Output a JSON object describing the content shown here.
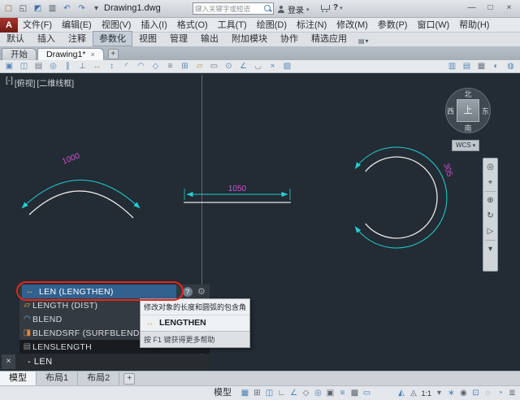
{
  "colors": {
    "canvas_bg": "#232b34",
    "entity_white": "#e8e8e8",
    "entity_cyan": "#21d1d1",
    "dimension_magenta": "#d24fd2",
    "suggestion_highlight": "#30618f",
    "annotation_red": "#e8241b"
  },
  "titlebar": {
    "qat_icons": [
      {
        "name": "new-file-icon",
        "glyph": "▢"
      },
      {
        "name": "open-file-icon",
        "glyph": "◱"
      },
      {
        "name": "save-icon",
        "glyph": "◩"
      },
      {
        "name": "plot-icon",
        "glyph": "▥"
      },
      {
        "name": "undo-icon",
        "glyph": "↶"
      },
      {
        "name": "redo-icon",
        "glyph": "↷"
      },
      {
        "name": "qat-dropdown-icon",
        "glyph": "▾"
      }
    ],
    "title": "Drawing1.dwg",
    "search_placeholder": "键入关键字或短语",
    "login_label": "登录",
    "help_label": "?",
    "minimize_glyph": "—",
    "maximize_glyph": "□",
    "close_glyph": "×"
  },
  "menubar": {
    "logo_letter": "A",
    "items": [
      "文件(F)",
      "编辑(E)",
      "视图(V)",
      "插入(I)",
      "格式(O)",
      "工具(T)",
      "绘图(D)",
      "标注(N)",
      "修改(M)",
      "参数(P)",
      "窗口(W)",
      "帮助(H)"
    ]
  },
  "ribbon_tabs": [
    {
      "label": "默认",
      "active": false
    },
    {
      "label": "插入",
      "active": false
    },
    {
      "label": "注释",
      "active": false
    },
    {
      "label": "参数化",
      "active": true
    },
    {
      "label": "视图",
      "active": false
    },
    {
      "label": "管理",
      "active": false
    },
    {
      "label": "输出",
      "active": false
    },
    {
      "label": "附加模块",
      "active": false
    },
    {
      "label": "协作",
      "active": false
    },
    {
      "label": "精选应用",
      "active": false
    }
  ],
  "file_tabs": {
    "start": "开始",
    "drawing": "Drawing1*"
  },
  "toolbar_icons": [
    {
      "name": "workspace-cube-icon",
      "glyph": "▣"
    },
    {
      "name": "coincident-constraint-icon",
      "glyph": "◫"
    },
    {
      "name": "collinear-constraint-icon",
      "glyph": "▤"
    },
    {
      "name": "concentric-constraint-icon",
      "glyph": "◎"
    },
    {
      "name": "parallel-constraint-icon",
      "glyph": "∥"
    },
    {
      "name": "perpendicular-constraint-icon",
      "glyph": "⊥"
    },
    {
      "name": "horizontal-constraint-icon",
      "glyph": "↔"
    },
    {
      "name": "vertical-constraint-icon",
      "glyph": "↕"
    },
    {
      "name": "tangent-constraint-icon",
      "glyph": "◜"
    },
    {
      "name": "smooth-constraint-icon",
      "glyph": "◠"
    },
    {
      "name": "symmetric-constraint-icon",
      "glyph": "◇"
    },
    {
      "name": "equal-constraint-icon",
      "glyph": "≡"
    },
    {
      "name": "auto-constrain-icon",
      "glyph": "⊞"
    },
    {
      "name": "show-constraints-icon",
      "glyph": "▱"
    },
    {
      "name": "hide-constraints-icon",
      "glyph": "▭"
    },
    {
      "name": "radius-dimension-icon",
      "glyph": "⊙"
    },
    {
      "name": "angular-dimension-icon",
      "glyph": "∠"
    },
    {
      "name": "aligned-dimension-icon",
      "glyph": "◡"
    },
    {
      "name": "delete-constraints-icon",
      "glyph": "×"
    },
    {
      "name": "parameters-manager-icon",
      "glyph": "▨"
    }
  ],
  "toolbar_right_icons": [
    {
      "name": "properties-palette-icon",
      "glyph": "▥"
    },
    {
      "name": "sheet-set-manager-icon",
      "glyph": "▤"
    },
    {
      "name": "tool-palettes-icon",
      "glyph": "▦"
    },
    {
      "name": "materials-browser-icon",
      "glyph": "◐"
    },
    {
      "name": "render-presets-icon",
      "glyph": "◍"
    }
  ],
  "viewport": {
    "controls_minus": "[-]",
    "controls_view": "[俯视]",
    "controls_style": "[二维线框]",
    "viewcube": {
      "north": "北",
      "south": "南",
      "west": "西",
      "east": "东",
      "top": "上",
      "wcs": "WCS"
    },
    "dimensions": {
      "left_arc": "1000",
      "middle_line": "1050",
      "right_arc": "305"
    }
  },
  "navbar_icons": [
    {
      "name": "navigation-wheel-icon",
      "glyph": "◎"
    },
    {
      "name": "pan-icon",
      "glyph": "⌖"
    },
    {
      "name": "zoom-icon",
      "glyph": "⊕"
    },
    {
      "name": "orbit-icon",
      "glyph": "↻"
    },
    {
      "name": "show-motion-icon",
      "glyph": "▷"
    },
    {
      "name": "navbar-options-chevron-icon",
      "glyph": "▾"
    }
  ],
  "command_popup": {
    "suggestions": [
      {
        "label": "LEN (LENGTHEN)",
        "glyph": "↔"
      },
      {
        "label": "LENGTH (DIST)",
        "glyph": "▱"
      },
      {
        "label": "BLEND",
        "glyph": "◠"
      },
      {
        "label": "BLENDSRF (SURFBLEND)",
        "glyph": "◨"
      },
      {
        "label": "LENSLENGTH",
        "glyph": "▤"
      }
    ],
    "help_badge": "?",
    "tooltip": {
      "description": "修改对象的长度和圆弧的包含角",
      "command": "LENGTHEN",
      "help": "按 F1 键获得更多帮助"
    }
  },
  "command_line": {
    "value": "- LEN"
  },
  "layout_tabs": {
    "model": "模型",
    "layout1": "布局1",
    "layout2": "布局2"
  },
  "statusbar": {
    "model_label": "模型",
    "left_icons": [
      {
        "name": "grid-icon",
        "glyph": "▦"
      },
      {
        "name": "snap-icon",
        "glyph": "⊞"
      },
      {
        "name": "infer-constraints-icon",
        "glyph": "◫"
      },
      {
        "name": "ortho-icon",
        "glyph": "∟"
      },
      {
        "name": "polar-tracking-icon",
        "glyph": "∠"
      },
      {
        "name": "isometric-drafting-icon",
        "glyph": "◇"
      },
      {
        "name": "object-snap-tracking-icon",
        "glyph": "◎"
      },
      {
        "name": "object-snap-icon",
        "glyph": "▣"
      },
      {
        "name": "lineweight-icon",
        "glyph": "≡"
      },
      {
        "name": "transparency-icon",
        "glyph": "▩"
      },
      {
        "name": "selection-cycling-icon",
        "glyph": "▭"
      }
    ],
    "right_icons": [
      {
        "name": "annotation-visibility-icon",
        "glyph": "◭"
      },
      {
        "name": "annotation-autoscale-icon",
        "glyph": "◬"
      },
      {
        "name": "annotation-scale-button",
        "glyph": "1:1"
      },
      {
        "name": "scale-caret-icon",
        "glyph": "▾"
      },
      {
        "name": "workspace-switching-icon",
        "glyph": "∗"
      },
      {
        "name": "annotation-monitor-icon",
        "glyph": "◉"
      },
      {
        "name": "quick-properties-icon",
        "glyph": "⊡"
      },
      {
        "name": "isolate-objects-icon",
        "glyph": "◌"
      },
      {
        "name": "graphics-performance-icon",
        "glyph": "◔"
      },
      {
        "name": "customize-icon",
        "glyph": "≣"
      }
    ]
  }
}
